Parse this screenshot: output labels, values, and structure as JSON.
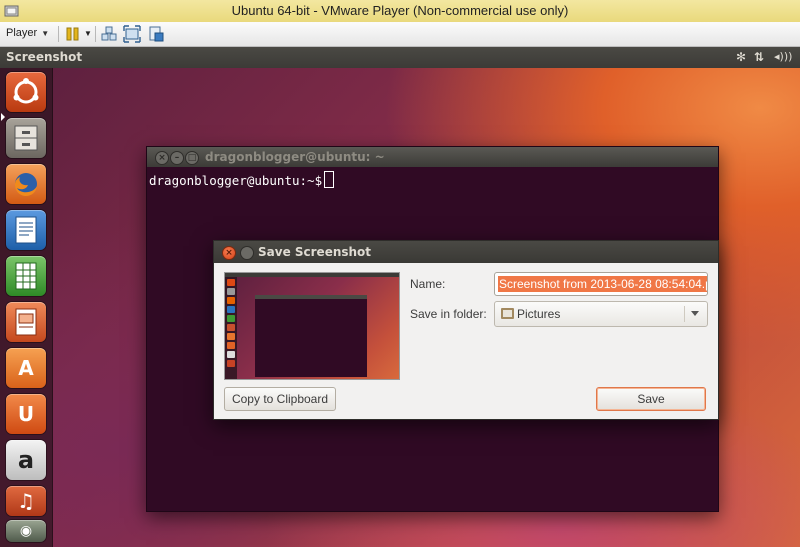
{
  "vmware": {
    "window_title": "Ubuntu 64-bit - VMware Player (Non-commercial use only)",
    "toolbar": {
      "player_label": "Player"
    }
  },
  "ubuntu_panel": {
    "title": "Screenshot",
    "indicators": {
      "bluetooth": "✻",
      "network": "⇅",
      "volume": "◂)))"
    }
  },
  "launcher": {
    "items": [
      {
        "name": "dash-home",
        "glyph": "◎",
        "color": "#dd4814"
      },
      {
        "name": "files",
        "glyph": "",
        "color": "#8e8a84"
      },
      {
        "name": "firefox",
        "glyph": "",
        "color": "#e66000"
      },
      {
        "name": "libreoffice-writer",
        "glyph": "",
        "color": "#2a74c0"
      },
      {
        "name": "libreoffice-calc",
        "glyph": "",
        "color": "#3d9b35"
      },
      {
        "name": "libreoffice-impress",
        "glyph": "",
        "color": "#c8502e"
      },
      {
        "name": "ubuntu-software-center",
        "glyph": "A",
        "color": "#e8752e"
      },
      {
        "name": "ubuntu-one",
        "glyph": "U",
        "color": "#e26226"
      },
      {
        "name": "amazon",
        "glyph": "a",
        "color": "#cfcfcf"
      },
      {
        "name": "ubuntu-one-music",
        "glyph": "",
        "color": "#c74225"
      },
      {
        "name": "screenshot-app",
        "glyph": "",
        "color": "#6f7a6b"
      }
    ]
  },
  "terminal": {
    "title": "dragonblogger@ubuntu: ~",
    "prompt": "dragonblogger@ubuntu:~$"
  },
  "dialog": {
    "title": "Save Screenshot",
    "name_label": "Name:",
    "name_value": "Screenshot from 2013-06-28 08:54:04.p",
    "folder_label": "Save in folder:",
    "folder_value": "Pictures",
    "copy_button": "Copy to Clipboard",
    "save_button": "Save"
  },
  "colors": {
    "ubuntu_orange": "#dd4814",
    "terminal_bg": "#300a24",
    "selection": "#f07746",
    "vmware_titlebar": "#f0e29a"
  }
}
